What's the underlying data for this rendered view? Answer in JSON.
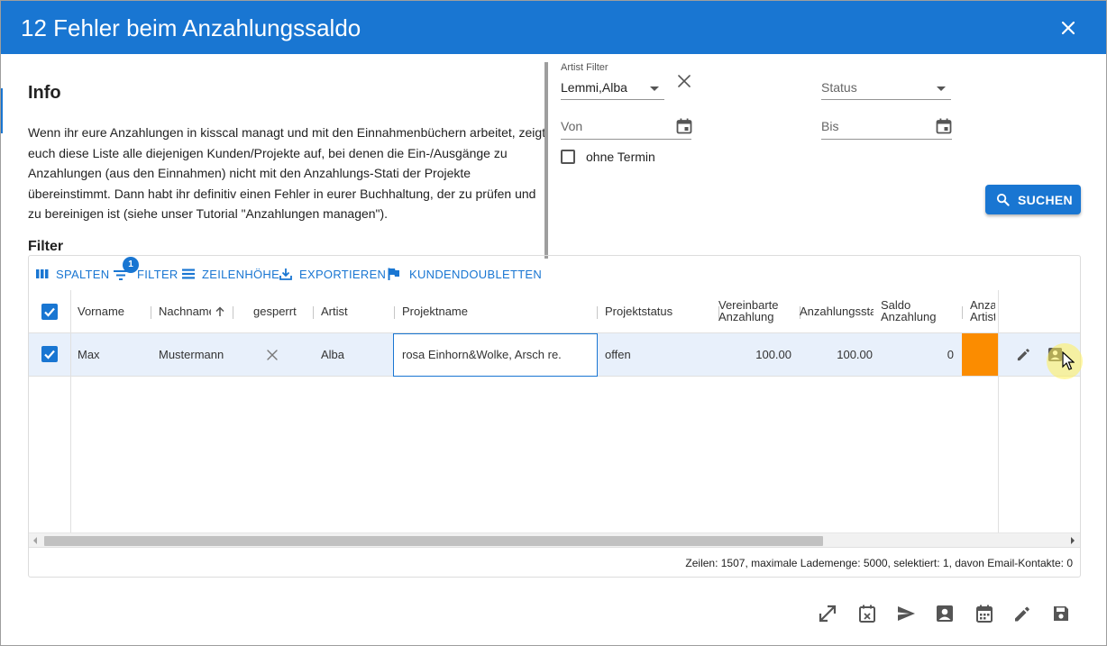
{
  "dialog": {
    "title": "12 Fehler beim Anzahlungssaldo",
    "close_icon": "close-icon"
  },
  "info": {
    "heading": "Info",
    "text": "Wenn ihr eure Anzahlungen in kisscal managt und mit den Einnahmenbüchern arbeitet, zeigt euch diese Liste alle diejenigen Kunden/Projekte auf, bei denen die Ein-/Ausgänge zu Anzahlungen (aus den Einnahmen) nicht mit den Anzahlungs-Stati der Projekte übereinstimmt. Dann habt ihr definitiv einen Fehler in eurer Buchhaltung, der zu prüfen und zu bereinigen ist (siehe unser Tutorial \"Anzahlungen managen\")."
  },
  "filter": {
    "heading": "Filter",
    "artist_label": "Artist Filter",
    "artist_value": "Lemmi,Alba",
    "status_placeholder": "Status",
    "von_placeholder": "Von",
    "bis_placeholder": "Bis",
    "ohne_termin_label": "ohne Termin",
    "ohne_termin_checked": false,
    "search_label": "SUCHEN"
  },
  "toolbar": {
    "spalten": "SPALTEN",
    "filter": "FILTER",
    "filter_badge": "1",
    "zeilenhoehe": "ZEILENHÖHE",
    "exportieren": "EXPORTIEREN",
    "kundendoubletten": "KUNDENDOUBLETTEN"
  },
  "columns": {
    "vorname": "Vorname",
    "nachname": "Nachname",
    "gesperrt": "gesperrt",
    "artist": "Artist",
    "projektname": "Projektname",
    "projektstatus": "Projektstatus",
    "vereinbarte_1": "Vereinbarte",
    "vereinbarte_2": "Anzahlung",
    "anzahlungsstatus": "Anzahlungsstatus",
    "saldo_1": "Saldo",
    "saldo_2": "Anzahlung",
    "anza_1": "Anzahlung",
    "anza_2": "Artist"
  },
  "rows": [
    {
      "checked": true,
      "vorname": "Max",
      "nachname": "Mustermann",
      "gesperrt_icon": "close-icon",
      "artist": "Alba",
      "projektname": "rosa Einhorn&Wolke, Arsch re.",
      "projektstatus": "offen",
      "vereinbarte": "100.00",
      "anzahlungsstatus": "100.00",
      "saldo": "0"
    }
  ],
  "grid_footer": "Zeilen: 1507, maximale Lademenge: 5000, selektiert: 1, davon Email-Kontakte: 0",
  "colors": {
    "primary": "#1976d2",
    "orange_cell": "#fb8c00",
    "selected_row": "#e8f0fb"
  },
  "bottom_icons": [
    "expand-icon",
    "calendar-remove-icon",
    "send-icon",
    "contact-card-icon",
    "calendar-icon",
    "edit-icon",
    "save-icon"
  ]
}
